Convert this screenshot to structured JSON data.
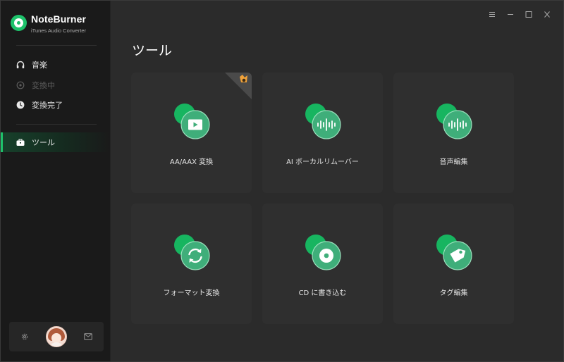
{
  "app": {
    "name": "NoteBurner",
    "subtitle": "iTunes Audio Converter"
  },
  "sidebar": {
    "items": [
      {
        "label": "音楽",
        "icon": "headphones-icon",
        "state": "normal"
      },
      {
        "label": "変換中",
        "icon": "converting-icon",
        "state": "disabled"
      },
      {
        "label": "変換完了",
        "icon": "clock-icon",
        "state": "normal"
      },
      {
        "label": "ツール",
        "icon": "toolbox-icon",
        "state": "active"
      }
    ]
  },
  "footer": {
    "icons": [
      "settings-icon",
      "avatar",
      "mail-icon"
    ]
  },
  "window_controls": [
    "menu-icon",
    "minimize-icon",
    "maximize-icon",
    "close-icon"
  ],
  "main": {
    "title": "ツール",
    "tools": [
      {
        "label": "AA/AAX 変換",
        "icon": "video-icon",
        "badge": "premium-badge-icon"
      },
      {
        "label": "AI ボーカルリムーバー",
        "icon": "waveform-icon"
      },
      {
        "label": "音声編集",
        "icon": "waveform-icon"
      },
      {
        "label": "フォーマット変換",
        "icon": "refresh-icon"
      },
      {
        "label": "CD に書き込む",
        "icon": "disc-icon"
      },
      {
        "label": "タグ編集",
        "icon": "tag-icon"
      }
    ]
  },
  "colors": {
    "accent": "#1ec26b",
    "sidebar_bg": "#1a1a1a",
    "main_bg": "#2b2b2b",
    "card_bg": "#2f2f2f",
    "badge": "#f0a23a"
  }
}
